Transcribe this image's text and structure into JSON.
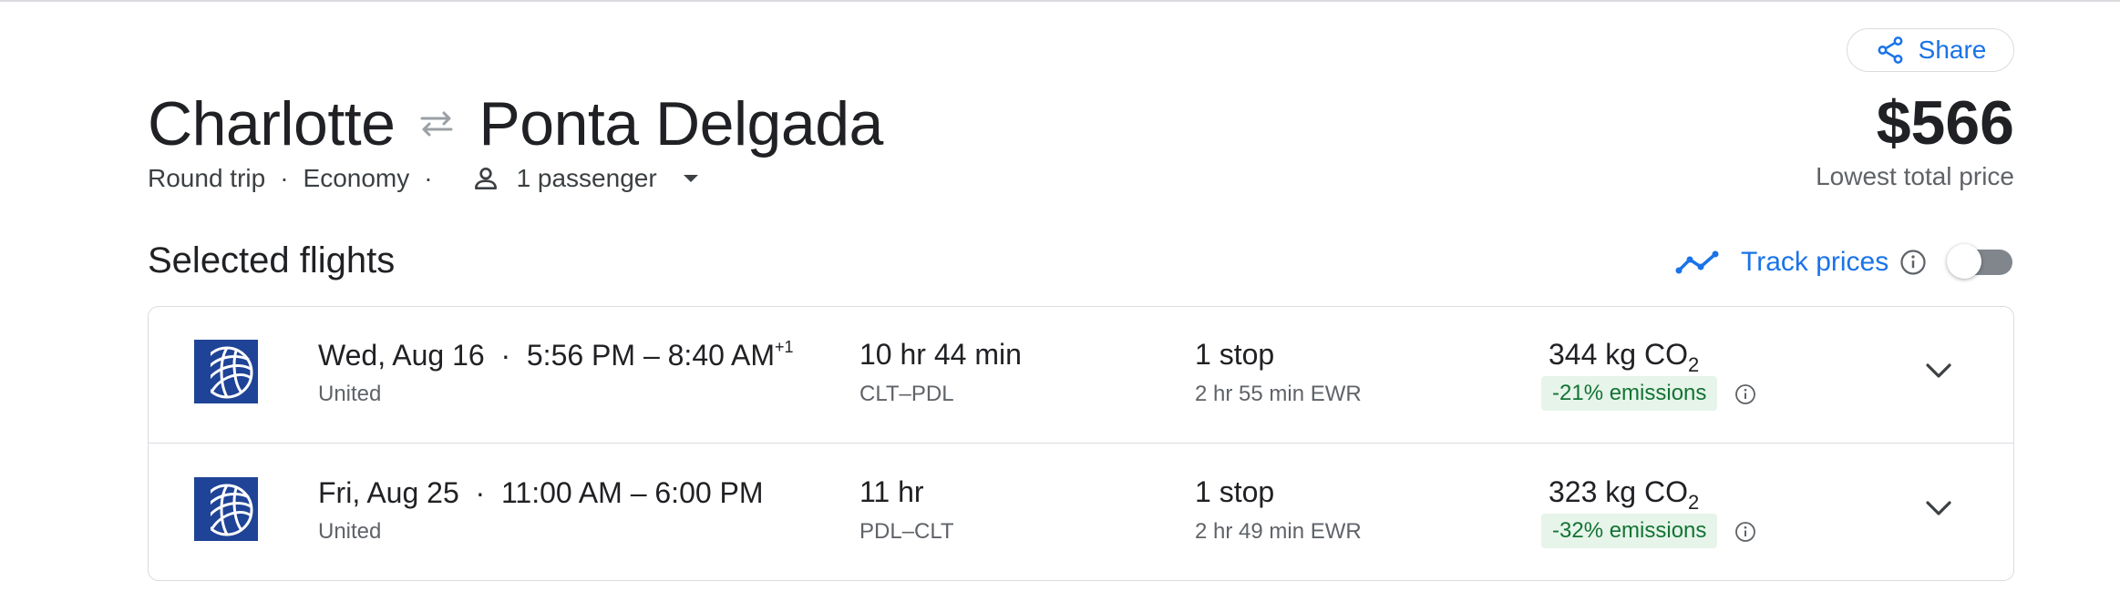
{
  "header": {
    "share_label": "Share",
    "origin": "Charlotte",
    "destination": "Ponta Delgada",
    "trip_type": "Round trip",
    "cabin": "Economy",
    "passengers": "1 passenger",
    "price": "$566",
    "price_label": "Lowest total price"
  },
  "selected": {
    "title": "Selected flights",
    "track_label": "Track prices",
    "track_enabled": false
  },
  "flights": [
    {
      "date": "Wed, Aug 16",
      "times": "5:56 PM – 8:40 AM",
      "day_offset": "+1",
      "airline": "United",
      "duration": "10 hr 44 min",
      "airports": "CLT–PDL",
      "stops": "1 stop",
      "layover": "2 hr 55 min EWR",
      "co2_value": "344 kg CO",
      "co2_sub": "2",
      "emissions": "-21% emissions"
    },
    {
      "date": "Fri, Aug 25",
      "times": "11:00 AM – 6:00 PM",
      "day_offset": "",
      "airline": "United",
      "duration": "11 hr",
      "airports": "PDL–CLT",
      "stops": "1 stop",
      "layover": "2 hr 49 min EWR",
      "co2_value": "323 kg CO",
      "co2_sub": "2",
      "emissions": "-32% emissions"
    }
  ],
  "icons": {
    "share": "share-icon",
    "swap": "swap-arrows-icon",
    "person": "person-icon",
    "caret": "caret-down-icon",
    "trend": "trend-line-icon",
    "info": "info-icon",
    "logo": "united-globe-logo",
    "chevron": "chevron-down-icon"
  },
  "colors": {
    "accent": "#1a73e8",
    "emissions_bg": "#e6f4ea",
    "emissions_text": "#137333",
    "united_blue": "#1f4396"
  }
}
